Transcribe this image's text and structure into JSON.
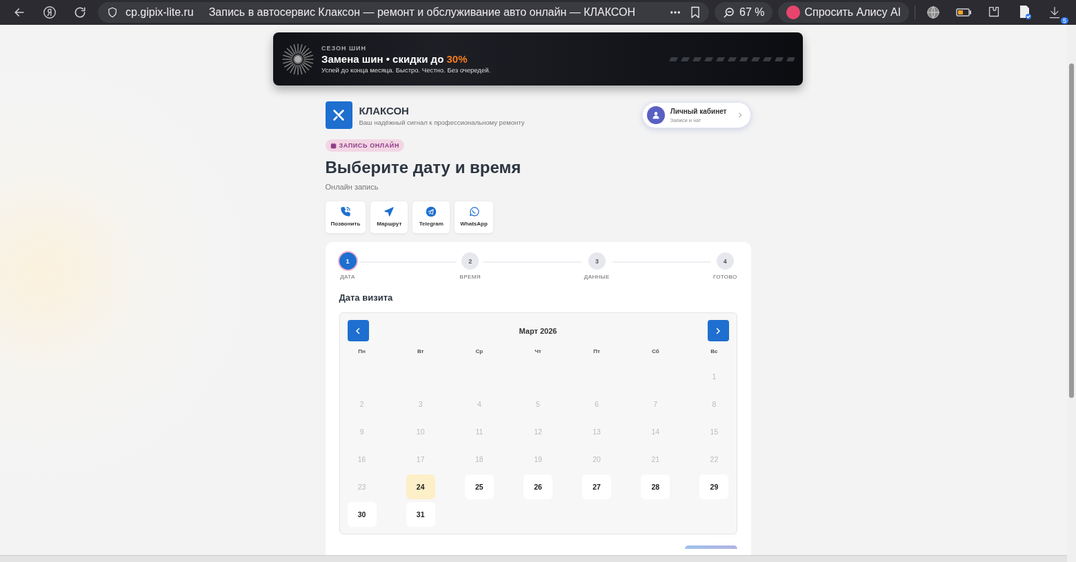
{
  "browser": {
    "url": "cp.gipix-lite.ru",
    "title": "Запись в автосервис Клаксон — ремонт и обслуживание авто онлайн — КЛАКСОН",
    "zoom": "67 %",
    "assistant": "Спросить Алису AI",
    "downloads_badge": "5"
  },
  "banner": {
    "eyebrow": "СЕЗОН ШИН",
    "headline": "Замена шин • скидки до ",
    "highlight": "30%",
    "subtitle": "Успей до конца месяца. Быстро. Честно. Без очередей."
  },
  "brand": {
    "name": "КЛАКСОН",
    "tagline": "Ваш надёжный сигнал к профессиональному ремонту"
  },
  "account": {
    "title": "Личный кабинет",
    "subtitle": "Записи и чат"
  },
  "badge": "ЗАПИСЬ ОНЛАЙН",
  "heading": "Выберите дату и время",
  "subheading": "Онлайн запись",
  "actions": [
    {
      "kind": "call",
      "label": "Позвонить"
    },
    {
      "kind": "route",
      "label": "Маршрут"
    },
    {
      "kind": "telegram",
      "label": "Telegram"
    },
    {
      "kind": "whatsapp",
      "label": "WhatsApp"
    }
  ],
  "steps": [
    {
      "number": "1",
      "label": "ДАТА",
      "selected": true
    },
    {
      "number": "2",
      "label": "ВРЕМЯ",
      "selected": false
    },
    {
      "number": "3",
      "label": "ДАННЫЕ",
      "selected": false
    },
    {
      "number": "4",
      "label": "ГОТОВО",
      "selected": false
    }
  ],
  "section_title": "Дата визита",
  "calendar": {
    "month": "Март 2026",
    "weekdays": [
      "Пн",
      "Вт",
      "Ср",
      "Чт",
      "Пт",
      "Сб",
      "Вс"
    ],
    "days": [
      {
        "kind": "blank"
      },
      {
        "kind": "blank"
      },
      {
        "kind": "blank"
      },
      {
        "kind": "blank"
      },
      {
        "kind": "blank"
      },
      {
        "kind": "blank"
      },
      {
        "kind": "day",
        "day": "1",
        "disabled": true,
        "selected": false
      },
      {
        "kind": "day",
        "day": "2",
        "disabled": true,
        "selected": false
      },
      {
        "kind": "day",
        "day": "3",
        "disabled": true,
        "selected": false
      },
      {
        "kind": "day",
        "day": "4",
        "disabled": true,
        "selected": false
      },
      {
        "kind": "day",
        "day": "5",
        "disabled": true,
        "selected": false
      },
      {
        "kind": "day",
        "day": "6",
        "disabled": true,
        "selected": false
      },
      {
        "kind": "day",
        "day": "7",
        "disabled": true,
        "selected": false
      },
      {
        "kind": "day",
        "day": "8",
        "disabled": true,
        "selected": false
      },
      {
        "kind": "day",
        "day": "9",
        "disabled": true,
        "selected": false
      },
      {
        "kind": "day",
        "day": "10",
        "disabled": true,
        "selected": false
      },
      {
        "kind": "day",
        "day": "11",
        "disabled": true,
        "selected": false
      },
      {
        "kind": "day",
        "day": "12",
        "disabled": true,
        "selected": false
      },
      {
        "kind": "day",
        "day": "13",
        "disabled": true,
        "selected": false
      },
      {
        "kind": "day",
        "day": "14",
        "disabled": true,
        "selected": false
      },
      {
        "kind": "day",
        "day": "15",
        "disabled": true,
        "selected": false
      },
      {
        "kind": "day",
        "day": "16",
        "disabled": true,
        "selected": false
      },
      {
        "kind": "day",
        "day": "17",
        "disabled": true,
        "selected": false
      },
      {
        "kind": "day",
        "day": "18",
        "disabled": true,
        "selected": false
      },
      {
        "kind": "day",
        "day": "19",
        "disabled": true,
        "selected": false
      },
      {
        "kind": "day",
        "day": "20",
        "disabled": true,
        "selected": false
      },
      {
        "kind": "day",
        "day": "21",
        "disabled": true,
        "selected": false
      },
      {
        "kind": "day",
        "day": "22",
        "disabled": true,
        "selected": false
      },
      {
        "kind": "day",
        "day": "23",
        "disabled": true,
        "selected": false
      },
      {
        "kind": "day",
        "day": "24",
        "disabled": false,
        "selected": true
      },
      {
        "kind": "day",
        "day": "25",
        "disabled": false,
        "selected": false
      },
      {
        "kind": "day",
        "day": "26",
        "disabled": false,
        "selected": false
      },
      {
        "kind": "day",
        "day": "27",
        "disabled": false,
        "selected": false
      },
      {
        "kind": "day",
        "day": "28",
        "disabled": false,
        "selected": false
      },
      {
        "kind": "day",
        "day": "29",
        "disabled": false,
        "selected": false
      },
      {
        "kind": "day",
        "day": "30",
        "disabled": false,
        "selected": false
      },
      {
        "kind": "day",
        "day": "31",
        "disabled": false,
        "selected": false
      }
    ]
  }
}
